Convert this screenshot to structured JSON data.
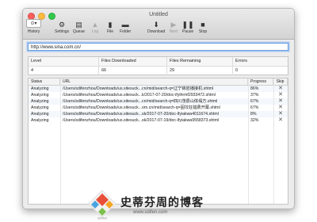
{
  "window": {
    "title": "Untitled"
  },
  "toolbar": {
    "history": "History",
    "history_box": "⊙▾",
    "settings": "Settings",
    "queue": "Queue",
    "log": "Log",
    "file": "File",
    "folder": "Folder",
    "download": "Download",
    "next": "Next",
    "pause": "Pause",
    "stop": "Stop"
  },
  "url_field": {
    "value": "http://www.sina.com.cn/"
  },
  "stats": {
    "headers": [
      "Level",
      "Files Downloaded",
      "Files Remaining",
      "Errors"
    ],
    "values": [
      "4",
      "66",
      "29",
      "0"
    ]
  },
  "table": {
    "headers": [
      "Status",
      "URL",
      "Progress",
      "Skip"
    ],
    "rows": [
      {
        "status": "Analyzing",
        "url": "/Users/sdifenzhou/Downloads/us.sitesuck...cn/mid/search-q=辽宁锦岩播接机.shtml",
        "progress": "86%"
      },
      {
        "status": "Analyzing",
        "url": "/Users/sdifenzhou/Downloads/us.sitesuck...k/2017-07-20/doc-ifyihrmf2933472.shtml",
        "progress": "37%"
      },
      {
        "status": "Analyzing",
        "url": "/Users/sdifenzhou/Downloads/us.sitesuck...cn/mid/search-q=四川茂县山体塌方.shtml",
        "progress": "67%"
      },
      {
        "status": "Analyzing",
        "url": "/Users/sdifenzhou/Downloads/us.sitesuck...om.cn/mid/search-q=固坟狂猎费开幕.shtml",
        "progress": "67%"
      },
      {
        "status": "Analyzing",
        "url": "/Users/sdifenzhou/Downloads/us.sitesuck...sk/2017-07-20/doc-ifyiakwa4011674.shtml",
        "progress": "8%"
      },
      {
        "status": "Analyzing",
        "url": "/Users/sdifenzhou/Downloads/us.sitesuck...sk/2017-07-19/doc-ifyiakwa9558373.shtml",
        "progress": "32%"
      }
    ],
    "skip_icon": "close-icon"
  },
  "watermark": {
    "logo_text": "SDIFEN",
    "title": "史蒂芬周的博客",
    "url": "www.sdifen.com"
  }
}
